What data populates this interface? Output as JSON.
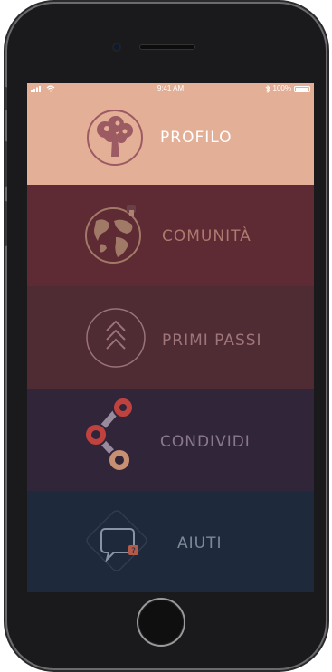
{
  "status_bar": {
    "time": "9:41 AM",
    "battery_percent": "100%",
    "signal_icon": "signal-bars-icon",
    "wifi_icon": "wifi-icon",
    "bluetooth_icon": "bluetooth-icon",
    "battery_icon": "battery-icon"
  },
  "menu": [
    {
      "label": "PROFILO",
      "icon": "tree-icon",
      "bg": "#e4af97",
      "color": "#ffffff"
    },
    {
      "label": "COMUNITÀ",
      "icon": "globe-icon",
      "bg": "#5e2a33",
      "color": "#ad7a6f"
    },
    {
      "label": "PRIMI PASSI",
      "icon": "chevrons-up-icon",
      "bg": "#4f2b34",
      "color": "#9e767a"
    },
    {
      "label": "CONDIVIDI",
      "icon": "share-icon",
      "bg": "#31253a",
      "color": "#8a7890"
    },
    {
      "label": "AIUTI",
      "icon": "chat-help-icon",
      "bg": "#1e2a3b",
      "color": "#7f8899"
    }
  ],
  "colors": {
    "phone_frame": "#1a1a1c",
    "accent_red": "#c0423f",
    "accent_tan": "#c89073"
  }
}
